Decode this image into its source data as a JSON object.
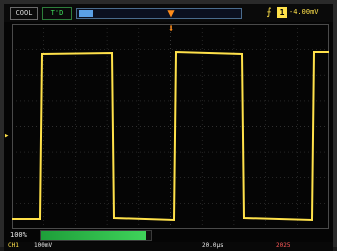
{
  "status": {
    "mode": "COOL",
    "trigger_status": "T'D",
    "trigger_pos_glyph": "▼",
    "edge_glyph": "⨍",
    "trigger_source": "1",
    "trigger_level": "-4.00mV"
  },
  "markers": {
    "ch1_glyph": "▸",
    "trigger_glyph": "⬇"
  },
  "scale": {
    "ch1_percent": "100%",
    "progress": 0.95
  },
  "bottom": {
    "ch_label": "CH1",
    "ch_volts": "100mV",
    "time": "20.0μs",
    "date": "2025"
  },
  "colors": {
    "trace": "#ffe14a",
    "grid": "#3b3b3b",
    "accent": "#ff8c1a"
  },
  "icons": {
    "trigger_marker": "trigger-marker-icon",
    "edge": "rising-edge-icon",
    "channel_marker": "channel-marker-icon"
  }
}
